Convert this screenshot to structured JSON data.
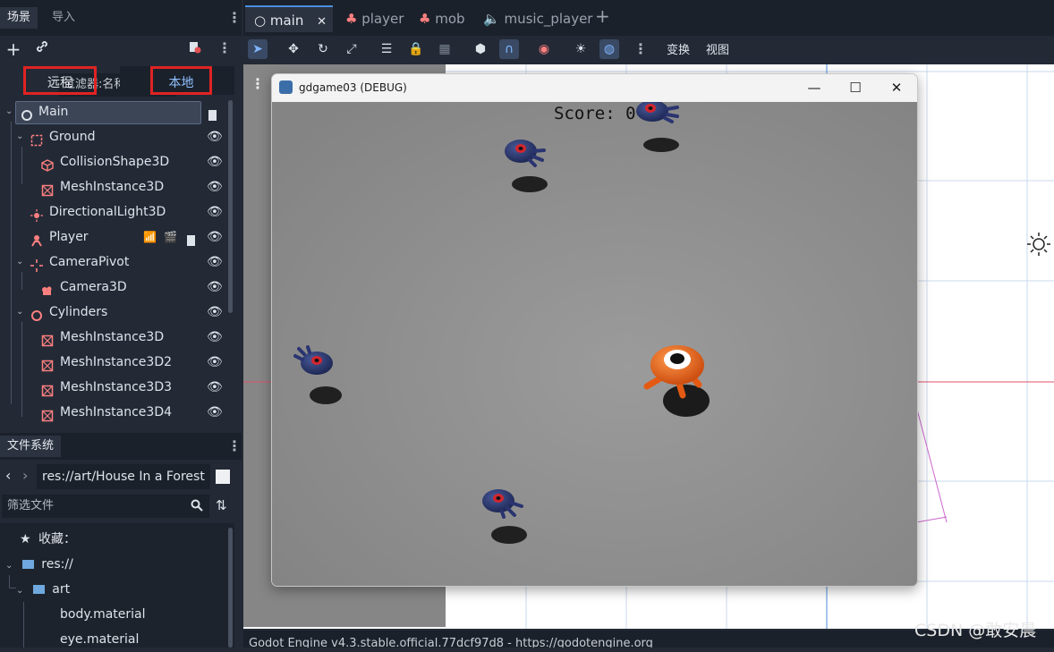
{
  "left_dock": {
    "tabs": [
      "场景",
      "导入"
    ],
    "filter_placeholder": "过滤器:名称、t:",
    "remote_label": "远程",
    "local_label": "本地",
    "tree": [
      {
        "label": "Main",
        "icon": "node3d-icon"
      },
      {
        "label": "Ground",
        "icon": "static-body-icon"
      },
      {
        "label": "CollisionShape3D",
        "icon": "collision-shape-icon"
      },
      {
        "label": "MeshInstance3D",
        "icon": "mesh-instance-icon"
      },
      {
        "label": "DirectionalLight3D",
        "icon": "light-icon"
      },
      {
        "label": "Player",
        "icon": "character-icon"
      },
      {
        "label": "CameraPivot",
        "icon": "marker-icon"
      },
      {
        "label": "Camera3D",
        "icon": "camera-icon"
      },
      {
        "label": "Cylinders",
        "icon": "node3d-icon"
      },
      {
        "label": "MeshInstance3D",
        "icon": "mesh-instance-icon"
      },
      {
        "label": "MeshInstance3D2",
        "icon": "mesh-instance-icon"
      },
      {
        "label": "MeshInstance3D3",
        "icon": "mesh-instance-icon"
      },
      {
        "label": "MeshInstance3D4",
        "icon": "mesh-instance-icon"
      }
    ]
  },
  "filesystem": {
    "title": "文件系统",
    "path": "res://art/House In a Forest",
    "filter_placeholder": "筛选文件",
    "items": [
      {
        "label": "收藏：",
        "icon": "star-icon"
      },
      {
        "label": "res://",
        "icon": "folder-icon"
      },
      {
        "label": "art",
        "icon": "folder-icon"
      },
      {
        "label": "body.material",
        "icon": "material-icon"
      },
      {
        "label": "eye.material",
        "icon": "material-icon"
      }
    ]
  },
  "main_tabs": [
    {
      "label": "main",
      "icon": "scene-icon"
    },
    {
      "label": "player",
      "icon": "character-icon"
    },
    {
      "label": "mob",
      "icon": "character-icon"
    },
    {
      "label": "music_player",
      "icon": "audio-icon"
    }
  ],
  "toolbar": {
    "transform_label": "变换",
    "view_label": "视图"
  },
  "game_window": {
    "title": "gdgame03 (DEBUG)",
    "score_text": "Score: 0"
  },
  "status_text": "Godot Engine v4.3.stable.official.77dcf97d8 - https://godotengine.org",
  "watermark": "CSDN @敢安晨",
  "colors": {
    "accent": "#4a8ede",
    "highlight_red": "#e02323",
    "node_red": "#fc7f7f"
  }
}
